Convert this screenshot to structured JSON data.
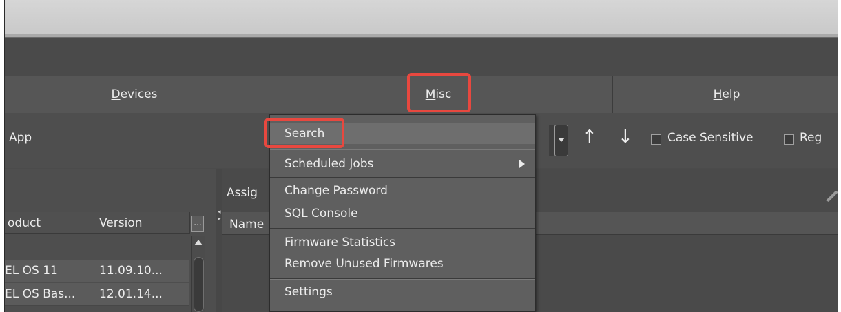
{
  "menubar": {
    "devices_label": "Devices",
    "misc_label": "Misc",
    "help_label": "Help"
  },
  "toolbar": {
    "app_label": "App",
    "case_sensitive_label": "Case Sensitive",
    "regex_label_partial": "Reg",
    "up_arrow": "↑",
    "down_arrow": "↓"
  },
  "left_table": {
    "columns": [
      "oduct",
      "Version"
    ],
    "more_button": "...",
    "rows": [
      {
        "product": "EL OS 11",
        "version": "11.09.10..."
      },
      {
        "product": "EL OS Bas...",
        "version": "12.01.14..."
      }
    ]
  },
  "right_pane": {
    "assign_label": "Assig",
    "name_header": "Name"
  },
  "misc_menu": {
    "items": [
      {
        "label": "Search",
        "highlighted": true
      },
      {
        "label": "Scheduled Jobs",
        "has_submenu": true
      },
      {
        "label": "Change Password"
      },
      {
        "label": "SQL Console"
      },
      {
        "label": "Firmware Statistics"
      },
      {
        "label": "Remove Unused Firmwares"
      },
      {
        "label": "Settings"
      }
    ]
  },
  "colors": {
    "highlight": "#e8483f",
    "background": "#4b4b4b",
    "menu_background": "#5f5f5f"
  },
  "icons": [
    "up-arrow-icon",
    "down-arrow-icon",
    "chevron-down-icon",
    "submenu-arrow-icon",
    "pencil-icon",
    "scroll-up-icon"
  ]
}
